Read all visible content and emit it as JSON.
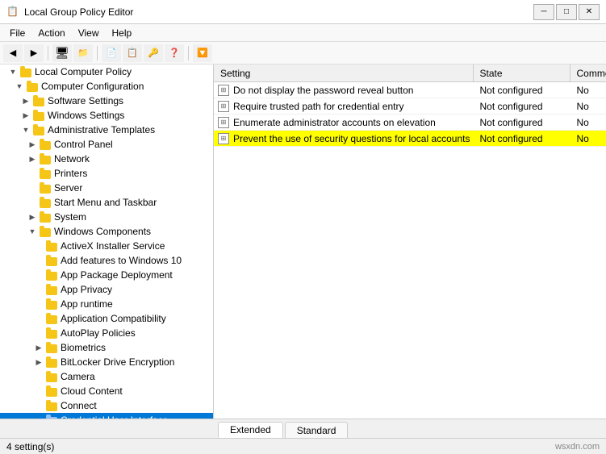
{
  "window": {
    "title": "Local Group Policy Editor",
    "icon": "📋"
  },
  "menu": {
    "items": [
      "File",
      "Action",
      "View",
      "Help"
    ]
  },
  "toolbar": {
    "buttons": [
      "◀",
      "▶",
      "⬆",
      "🖥",
      "🔲",
      "📄",
      "📋",
      "🔍",
      "🛡"
    ]
  },
  "tree": {
    "items": [
      {
        "id": "local-computer-policy",
        "label": "Local Computer Policy",
        "indent": 0,
        "expanded": true,
        "isRoot": true
      },
      {
        "id": "computer-configuration",
        "label": "Computer Configuration",
        "indent": 1,
        "expanded": true,
        "hasExpander": true
      },
      {
        "id": "software-settings",
        "label": "Software Settings",
        "indent": 2,
        "hasExpander": true
      },
      {
        "id": "windows-settings",
        "label": "Windows Settings",
        "indent": 2,
        "hasExpander": true
      },
      {
        "id": "administrative-templates",
        "label": "Administrative Templates",
        "indent": 2,
        "expanded": true,
        "hasExpander": true
      },
      {
        "id": "control-panel",
        "label": "Control Panel",
        "indent": 3,
        "hasExpander": true
      },
      {
        "id": "network",
        "label": "Network",
        "indent": 3,
        "hasExpander": true
      },
      {
        "id": "printers",
        "label": "Printers",
        "indent": 3
      },
      {
        "id": "server",
        "label": "Server",
        "indent": 3
      },
      {
        "id": "start-menu-taskbar",
        "label": "Start Menu and Taskbar",
        "indent": 3
      },
      {
        "id": "system",
        "label": "System",
        "indent": 3,
        "hasExpander": true
      },
      {
        "id": "windows-components",
        "label": "Windows Components",
        "indent": 3,
        "expanded": true,
        "hasExpander": true
      },
      {
        "id": "activex-installer",
        "label": "ActiveX Installer Service",
        "indent": 4
      },
      {
        "id": "add-features",
        "label": "Add features to Windows 10",
        "indent": 4
      },
      {
        "id": "app-package",
        "label": "App Package Deployment",
        "indent": 4
      },
      {
        "id": "app-privacy",
        "label": "App Privacy",
        "indent": 4
      },
      {
        "id": "app-runtime",
        "label": "App runtime",
        "indent": 4
      },
      {
        "id": "application-compatibility",
        "label": "Application Compatibility",
        "indent": 4
      },
      {
        "id": "autoplay",
        "label": "AutoPlay Policies",
        "indent": 4
      },
      {
        "id": "biometrics",
        "label": "Biometrics",
        "indent": 4,
        "hasExpander": true
      },
      {
        "id": "bitlocker",
        "label": "BitLocker Drive Encryption",
        "indent": 4,
        "hasExpander": true
      },
      {
        "id": "camera",
        "label": "Camera",
        "indent": 4
      },
      {
        "id": "cloud-content",
        "label": "Cloud Content",
        "indent": 4
      },
      {
        "id": "connect",
        "label": "Connect",
        "indent": 4
      },
      {
        "id": "credential-ui",
        "label": "Credential User Interface",
        "indent": 4,
        "selected": true
      }
    ]
  },
  "list": {
    "columns": [
      "Setting",
      "State",
      "Comment"
    ],
    "rows": [
      {
        "name": "Do not display the password reveal button",
        "state": "Not configured",
        "comment": "No",
        "highlighted": false
      },
      {
        "name": "Require trusted path for credential entry",
        "state": "Not configured",
        "comment": "No",
        "highlighted": false
      },
      {
        "name": "Enumerate administrator accounts on elevation",
        "state": "Not configured",
        "comment": "No",
        "highlighted": false
      },
      {
        "name": "Prevent the use of security questions for local accounts",
        "state": "Not configured",
        "comment": "No",
        "highlighted": true
      }
    ]
  },
  "tabs": [
    "Extended",
    "Standard"
  ],
  "active_tab": "Extended",
  "status": {
    "text": "4 setting(s)",
    "right": "wsxdn.com"
  }
}
